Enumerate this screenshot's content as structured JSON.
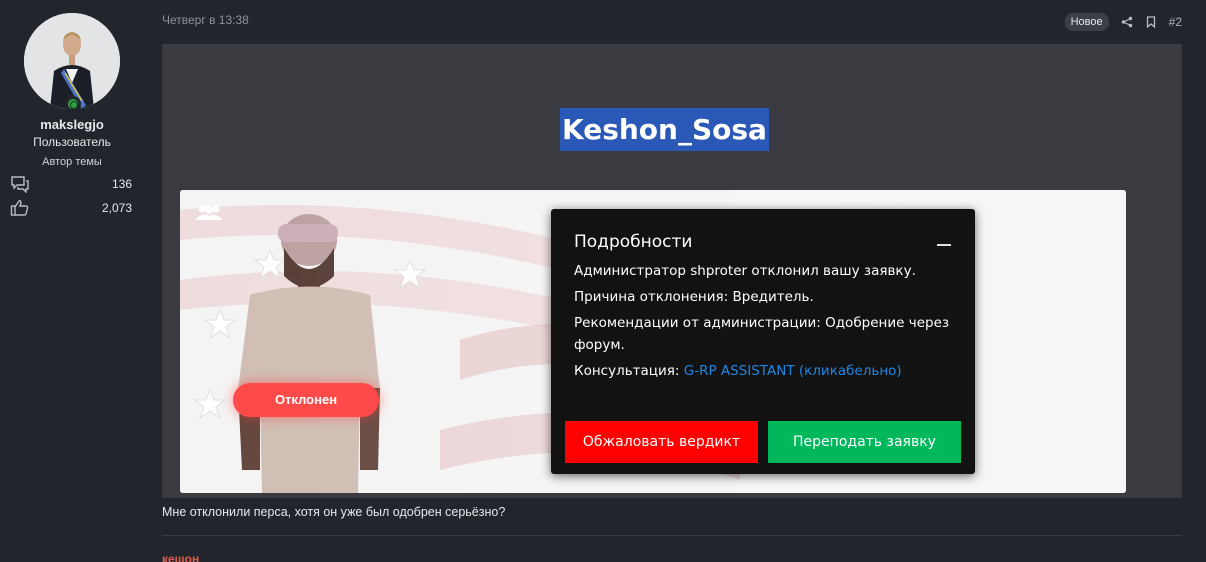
{
  "user": {
    "username": "makslegjo",
    "title": "Пользователь",
    "badge": "Автор темы",
    "stats": [
      {
        "icon": "messages-icon",
        "value": "136"
      },
      {
        "icon": "thumbs-up-icon",
        "value": "2,073"
      }
    ],
    "online_color": "#2f9e44"
  },
  "post": {
    "date": "Четверг в 13:38",
    "new_badge": "Новое",
    "number": "#2",
    "character_name": "Keshon_Sosa",
    "text": "Мне отклонили перса, хотя он уже был одобрен серьёзно?"
  },
  "screenshot": {
    "status": "Отклонен",
    "dialog": {
      "title": "Подробности",
      "line1": "Администратор shproter отклонил вашу заявку.",
      "line2": "Причина отклонения: Вредитель.",
      "line3": "Рекомендации от администрации: Одобрение через форум.",
      "line4_prefix": "Консультация:",
      "line4_link": "G-RP ASSISTANT (кликабельно)",
      "appeal_button": "Обжаловать вердикт",
      "resubmit_button": "Переподать заявку"
    },
    "colors": {
      "red": "#ff0000",
      "green": "#00b85c",
      "link": "#1e88e5"
    }
  },
  "next_post": {
    "author": "кешон"
  }
}
